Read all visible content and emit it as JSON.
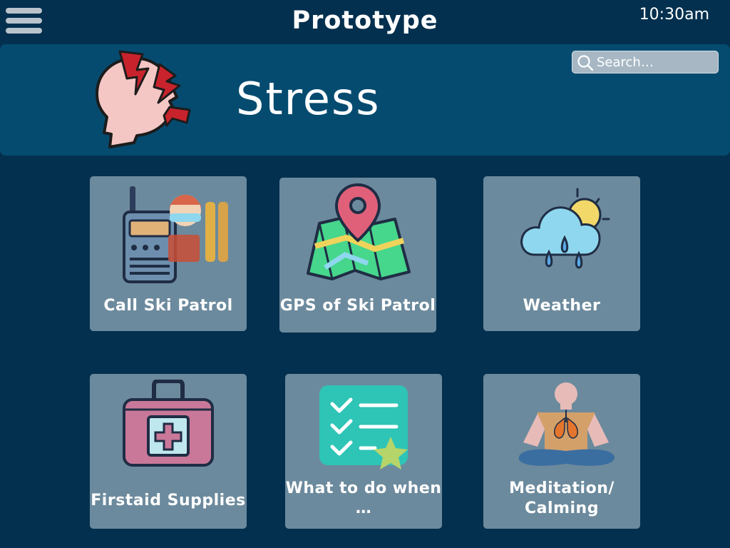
{
  "header": {
    "menu_icon": "hamburger-menu-icon",
    "title": "Prototype",
    "time": "10:30am"
  },
  "banner": {
    "icon": "stressed-head-icon",
    "title": "Stress",
    "search": {
      "placeholder": "Search…",
      "value": "",
      "icon": "search-icon"
    }
  },
  "tiles": [
    {
      "label": "Call Ski Patrol",
      "icon": "walkie-talkie-ski-patrol-icon"
    },
    {
      "label": "GPS of Ski Patrol",
      "icon": "map-pin-icon"
    },
    {
      "label": "Weather",
      "icon": "rain-cloud-sun-icon"
    },
    {
      "label": "Firstaid Supplies",
      "icon": "first-aid-kit-icon"
    },
    {
      "label": "What to do when …",
      "icon": "checklist-icon"
    },
    {
      "label": "Meditation/ Calming",
      "icon": "meditation-person-icon"
    }
  ],
  "colors": {
    "background": "#04304f",
    "banner": "#054b70",
    "tile": "#6c8a9d"
  }
}
